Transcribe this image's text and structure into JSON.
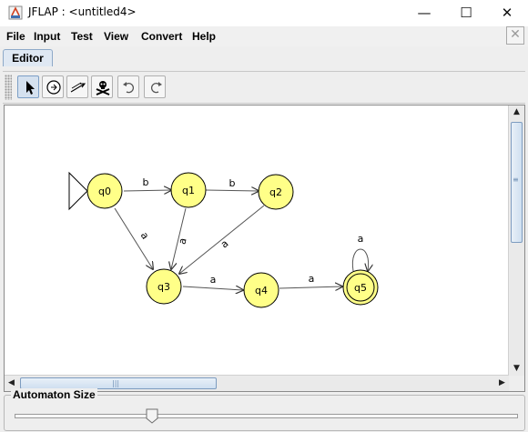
{
  "window": {
    "title": "JFLAP : <untitled4>",
    "minimize_glyph": "—",
    "maximize_glyph": "☐",
    "close_glyph": "✕",
    "app_icon": "jflap-icon"
  },
  "menu": {
    "items": [
      "File",
      "Input",
      "Test",
      "View",
      "Convert",
      "Help"
    ],
    "close_document_glyph": "✕"
  },
  "tabs": [
    {
      "label": "Editor",
      "active": true
    }
  ],
  "toolbar": {
    "tools": [
      {
        "name": "attribute-editor",
        "icon": "pointer-arrow-icon",
        "selected": true
      },
      {
        "name": "state-creator",
        "icon": "state-circle-icon",
        "selected": false
      },
      {
        "name": "transition-creator",
        "icon": "transition-arrow-icon",
        "selected": false
      },
      {
        "name": "deleter",
        "icon": "skull-crossbones-icon",
        "selected": false
      },
      {
        "name": "undo",
        "icon": "undo-icon",
        "selected": false
      },
      {
        "name": "redo",
        "icon": "redo-icon",
        "selected": false
      }
    ]
  },
  "automaton": {
    "state_fill": "#ffff88",
    "states": [
      {
        "id": "q0",
        "label": "q0",
        "initial": true,
        "final": false
      },
      {
        "id": "q1",
        "label": "q1",
        "initial": false,
        "final": false
      },
      {
        "id": "q2",
        "label": "q2",
        "initial": false,
        "final": false
      },
      {
        "id": "q3",
        "label": "q3",
        "initial": false,
        "final": false
      },
      {
        "id": "q4",
        "label": "q4",
        "initial": false,
        "final": false
      },
      {
        "id": "q5",
        "label": "q5",
        "initial": false,
        "final": true
      }
    ],
    "transitions": [
      {
        "from": "q0",
        "to": "q1",
        "symbol": "b"
      },
      {
        "from": "q1",
        "to": "q2",
        "symbol": "b"
      },
      {
        "from": "q0",
        "to": "q3",
        "symbol": "a"
      },
      {
        "from": "q1",
        "to": "q3",
        "symbol": "a"
      },
      {
        "from": "q2",
        "to": "q3",
        "symbol": "a"
      },
      {
        "from": "q3",
        "to": "q4",
        "symbol": "a"
      },
      {
        "from": "q4",
        "to": "q5",
        "symbol": "a"
      },
      {
        "from": "q5",
        "to": "q5",
        "symbol": "a"
      }
    ]
  },
  "scroll": {
    "vertical_glyphs": [
      "▲",
      "▼",
      "≡"
    ],
    "horizontal_glyphs": [
      "◀",
      "▶",
      "|||"
    ]
  },
  "automaton_size": {
    "label": "Automaton Size",
    "value_fraction": 0.29
  }
}
